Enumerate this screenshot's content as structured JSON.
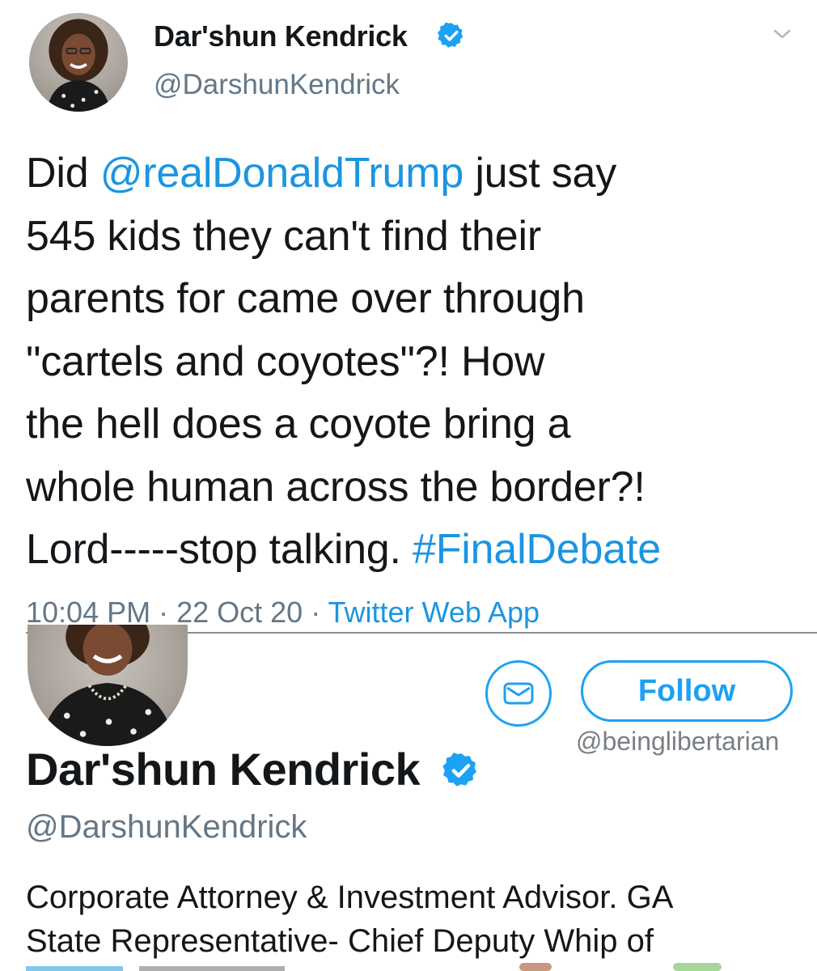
{
  "tweet": {
    "author_name": "Dar'shun Kendrick",
    "author_handle": "@DarshunKendrick",
    "text_lines": [
      {
        "parts": [
          {
            "t": "Did ",
            "link": false
          },
          {
            "t": "@realDonaldTrump",
            "link": true
          },
          {
            "t": " just say",
            "link": false
          }
        ]
      },
      {
        "parts": [
          {
            "t": "545 kids they can't find their",
            "link": false
          }
        ]
      },
      {
        "parts": [
          {
            "t": "parents for came over through",
            "link": false
          }
        ]
      },
      {
        "parts": [
          {
            "t": "\"cartels and coyotes\"?! How",
            "link": false
          }
        ]
      },
      {
        "parts": [
          {
            "t": "the hell does a coyote bring a",
            "link": false
          }
        ]
      },
      {
        "parts": [
          {
            "t": "whole human across the border?!",
            "link": false
          }
        ]
      },
      {
        "parts": [
          {
            "t": "Lord-----stop talking. ",
            "link": false
          },
          {
            "t": "#FinalDebate",
            "link": true
          }
        ]
      }
    ],
    "time": "10:04 PM",
    "separator": " · ",
    "date": "22 Oct 20",
    "source": "Twitter Web App"
  },
  "profile": {
    "follow_label": "Follow",
    "watermark": "@beinglibertarian",
    "name": "Dar'shun Kendrick",
    "handle": "@DarshunKendrick",
    "bio_lines": [
      "Corporate Attorney & Investment Advisor. GA",
      "State Representative- Chief Deputy Whip of"
    ]
  },
  "icons": {
    "verified": "verified-badge-icon",
    "chevron": "chevron-down-icon",
    "message": "envelope-icon"
  },
  "colors": {
    "link": "#1b95e0",
    "accent": "#1da1f2",
    "muted": "#657786",
    "text": "#14171a"
  }
}
